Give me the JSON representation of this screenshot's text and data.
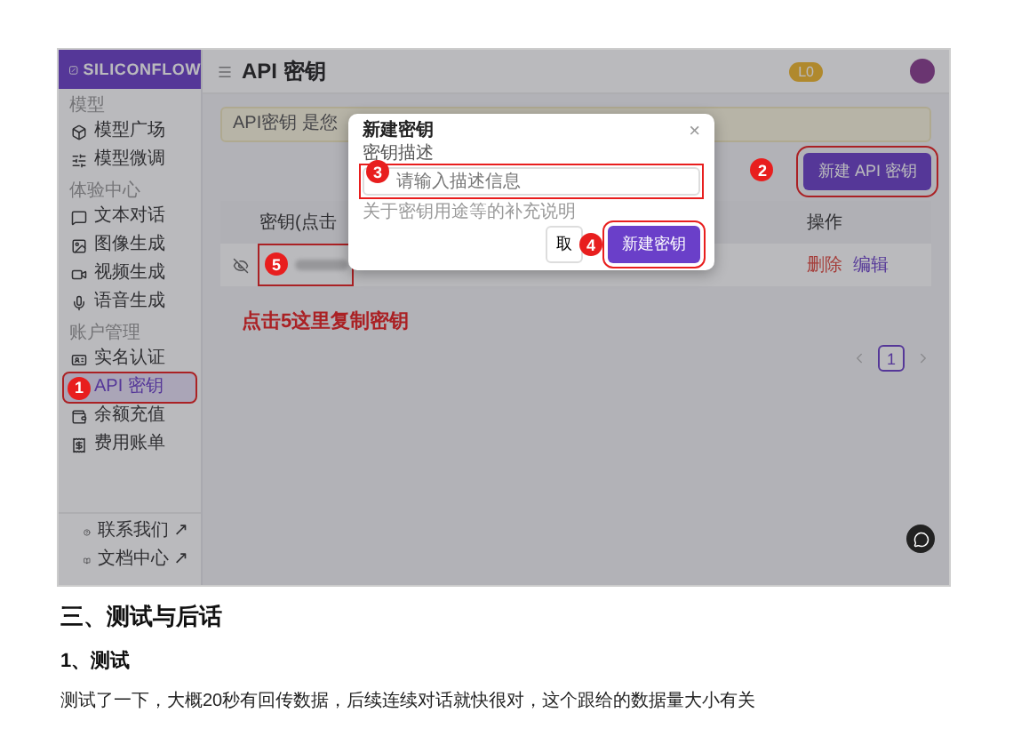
{
  "app": {
    "logo": "SILICONFLOW",
    "sidebar": {
      "sections": [
        {
          "label": "模型",
          "items": [
            {
              "label": "模型广场",
              "selected": false
            },
            {
              "label": "模型微调",
              "selected": false
            }
          ]
        },
        {
          "label": "体验中心",
          "items": [
            {
              "label": "文本对话",
              "selected": false
            },
            {
              "label": "图像生成",
              "selected": false
            },
            {
              "label": "视频生成",
              "selected": false
            },
            {
              "label": "语音生成",
              "selected": false
            }
          ]
        },
        {
          "label": "账户管理",
          "items": [
            {
              "label": "实名认证",
              "selected": false
            },
            {
              "label": "API 密钥",
              "selected": true,
              "marker": "1"
            },
            {
              "label": "余额充值",
              "selected": false
            },
            {
              "label": "费用账单",
              "selected": false
            }
          ]
        }
      ],
      "links": [
        {
          "label": "联系我们 ↗"
        },
        {
          "label": "文档中心 ↗"
        }
      ]
    },
    "header": {
      "title": "API 密钥",
      "level_badge": "L0"
    },
    "banner": "API密钥 是您",
    "new_key_button": {
      "label": "新建 API 密钥",
      "marker": "2"
    },
    "table": {
      "columns": [
        "密钥(点击",
        "操作"
      ],
      "rows": [
        {
          "marker": "5",
          "actions": [
            {
              "label": "删除",
              "kind": "danger"
            },
            {
              "label": "编辑",
              "kind": "link"
            }
          ]
        }
      ]
    },
    "caption": "点击5这里复制密钥",
    "pagination": {
      "pages": [
        {
          "label": "1",
          "selected": true
        }
      ]
    },
    "dialog": {
      "title": "新建密钥",
      "close": "×",
      "field_label": "密钥描述",
      "placeholder": "请输入描述信息",
      "field_marker": "3",
      "hint": "关于密钥用途等的补充说明",
      "cancel": "取",
      "confirm": {
        "label": "新建密钥",
        "marker": "4"
      }
    }
  },
  "article": {
    "heading": "三、测试与后话",
    "subheading": "1、测试",
    "paragraph": "测试了一下，大概20秒有回传数据，后续连续对话就快很对，这个跟给的数据量大小有关"
  }
}
